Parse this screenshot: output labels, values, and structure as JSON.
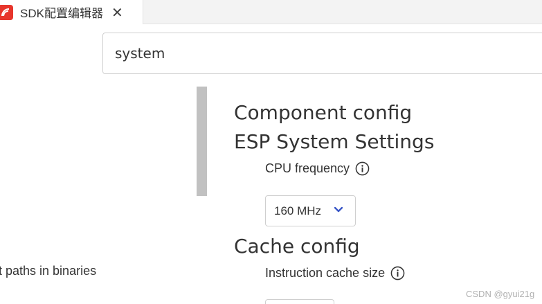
{
  "tab": {
    "title": "SDK配置编辑器",
    "close_glyph": "✕",
    "icon": "espressif-logo-icon"
  },
  "search": {
    "value": "system"
  },
  "sidebar": {
    "partial_item": "t paths in binaries"
  },
  "main": {
    "section_title": "Component config",
    "subsection_title": "ESP System Settings",
    "cpu_frequency": {
      "label": "CPU frequency",
      "value": "160 MHz"
    },
    "cache_title": "Cache config",
    "instruction_cache": {
      "label": "Instruction cache size"
    }
  },
  "watermark": "CSDN @gyui21g",
  "colors": {
    "logo_red": "#e7352c",
    "chevron_blue": "#3a57c7"
  }
}
